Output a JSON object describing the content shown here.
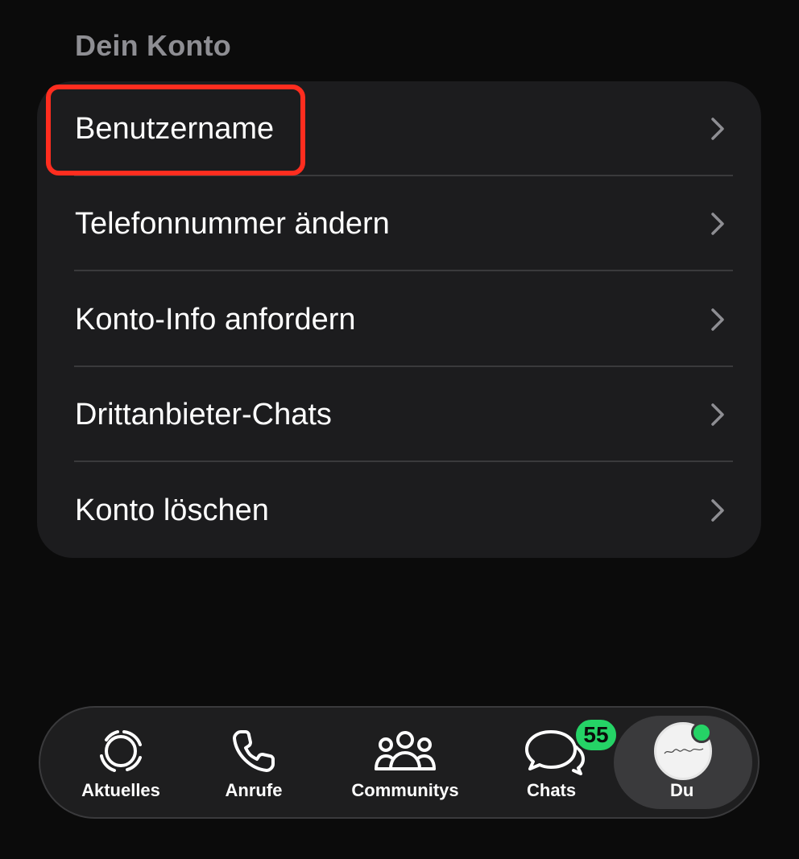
{
  "section": {
    "title": "Dein Konto"
  },
  "menu": {
    "items": [
      {
        "label": "Benutzername",
        "icon": "chevron-right-icon"
      },
      {
        "label": "Telefonnummer ändern",
        "icon": "chevron-right-icon"
      },
      {
        "label": "Konto-Info anfordern",
        "icon": "chevron-right-icon"
      },
      {
        "label": "Drittanbieter-Chats",
        "icon": "chevron-right-icon"
      },
      {
        "label": "Konto löschen",
        "icon": "chevron-right-icon"
      }
    ],
    "highlighted_item": "Benutzername",
    "highlight_color": "#ff2d1f"
  },
  "tabbar": {
    "tabs": [
      {
        "label": "Aktuelles",
        "icon": "status-icon"
      },
      {
        "label": "Anrufe",
        "icon": "phone-icon"
      },
      {
        "label": "Communitys",
        "icon": "community-icon"
      },
      {
        "label": "Chats",
        "icon": "chat-bubbles-icon",
        "badge": "55"
      },
      {
        "label": "Du",
        "icon": "avatar",
        "active": true
      }
    ],
    "accent_color": "#25d366"
  },
  "colors": {
    "background": "#0b0b0b",
    "card": "#1c1c1e",
    "text": "#ffffff",
    "secondary_text": "#8e8e93"
  }
}
